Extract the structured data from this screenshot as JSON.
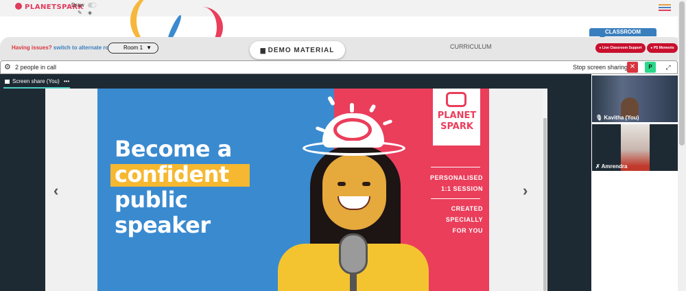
{
  "header": {
    "logo_text": "PLANETSPARK",
    "draw_label": "Draw",
    "pen_icon": "pencil-icon",
    "eraser_icon": "eraser-icon",
    "menu_icon": "hamburger-icon"
  },
  "room_bar": {
    "issue_prefix": "Having issues?",
    "issue_link": "switch to alternate room",
    "room_value": "Room 1",
    "demo_label": "DEMO MATERIAL",
    "curriculum_label": "CURRICULUM",
    "classroom_tab": "CLASSROOM",
    "live_support": "Live Classroom Support",
    "ps_moments": "PS Moments"
  },
  "call_bar": {
    "people_count": "2 people in call",
    "stop_sharing": "Stop screen sharing",
    "stop_icon": "✕",
    "p_button": "P",
    "expand_icon": "⤢"
  },
  "share": {
    "tab_label": "Screen share (You)",
    "more": "•••"
  },
  "slide": {
    "line1": "Become a",
    "line2": "confident",
    "line3": "public",
    "line4": "speaker",
    "logo_line1": "PLANET",
    "logo_line2": "SPARK",
    "caption1_a": "PERSONALISED",
    "caption1_b": "1:1 SESSION",
    "caption2_a": "CREATED SPECIALLY",
    "caption2_b": "FOR YOU"
  },
  "participants": [
    {
      "name": "Kavitha (You)",
      "mic": "mic-icon"
    },
    {
      "name": "Amrendra",
      "mic": "mic-off-icon"
    }
  ],
  "colors": {
    "brand_red": "#e03b5b",
    "link_blue": "#3a7fbd",
    "slide_blue": "#3a8ad0",
    "slide_red": "#ea3e5b",
    "highlight": "#f5b830"
  }
}
